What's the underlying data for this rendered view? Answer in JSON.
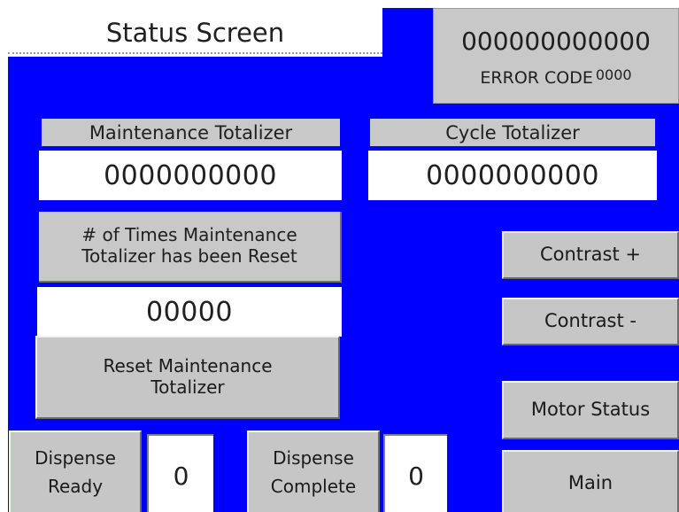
{
  "screen": {
    "title": "Status Screen",
    "error_panel": {
      "number": "000000000000",
      "error_label": "ERROR CODE",
      "error_value": "0000"
    },
    "maintenance_totalizer": {
      "label": "Maintenance Totalizer",
      "value": "0000000000"
    },
    "cycle_totalizer": {
      "label": "Cycle Totalizer",
      "value": "0000000000"
    },
    "reset_count": {
      "label_line1": "# of Times Maintenance",
      "label_line2": "Totalizer has been Reset",
      "value": "00000"
    },
    "reset_button": {
      "line1": "Reset Maintenance",
      "line2": "Totalizer"
    },
    "buttons": {
      "contrast_up": "Contrast +",
      "contrast_down": "Contrast -",
      "motor_status": "Motor Status",
      "main": "Main"
    },
    "dispense_ready": {
      "line1": "Dispense",
      "line2": "Ready",
      "value": "0"
    },
    "dispense_complete": {
      "line1": "Dispense",
      "line2": "Complete",
      "value": "0"
    }
  },
  "colors": {
    "background": "#0000ff",
    "field": "#ffffff",
    "label": "#c8c8c8"
  }
}
